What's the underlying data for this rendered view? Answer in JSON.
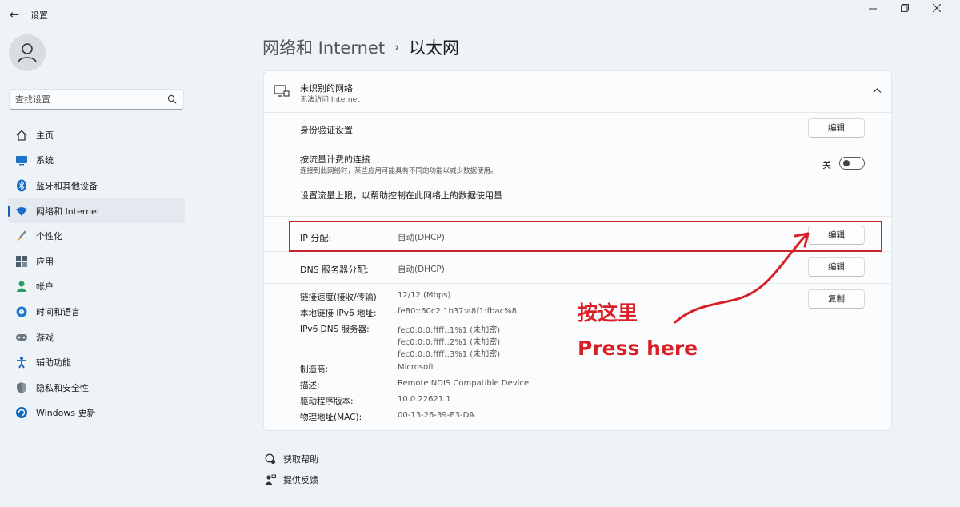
{
  "window": {
    "title": "设置",
    "controls": [
      "minimize",
      "maximize",
      "close"
    ]
  },
  "sidebar": {
    "search_placeholder": "查找设置",
    "items": [
      {
        "label": "主页",
        "icon": "home-icon",
        "color": "#333333"
      },
      {
        "label": "系统",
        "icon": "monitor-icon",
        "color": "#0f6cbd"
      },
      {
        "label": "蓝牙和其他设备",
        "icon": "bluetooth-icon",
        "color": "#0f6cbd"
      },
      {
        "label": "网络和 Internet",
        "icon": "wifi-icon",
        "color": "#0f6cbd",
        "active": true
      },
      {
        "label": "个性化",
        "icon": "brush-icon",
        "color": "#e8a33c"
      },
      {
        "label": "应用",
        "icon": "apps-icon",
        "color": "#4a5b6c"
      },
      {
        "label": "帐户",
        "icon": "person-icon",
        "color": "#2d9b63"
      },
      {
        "label": "时间和语言",
        "icon": "globe-clock-icon",
        "color": "#1a7bd0"
      },
      {
        "label": "游戏",
        "icon": "gamepad-icon",
        "color": "#6b7682"
      },
      {
        "label": "辅助功能",
        "icon": "accessibility-icon",
        "color": "#1a5fb4"
      },
      {
        "label": "隐私和安全性",
        "icon": "shield-icon",
        "color": "#6b7682"
      },
      {
        "label": "Windows 更新",
        "icon": "update-icon",
        "color": "#0f6cbd"
      }
    ]
  },
  "header": {
    "parent": "网络和 Internet",
    "separator": "›",
    "current": "以太网"
  },
  "network": {
    "name": "未识别的网络",
    "status": "无法访问 Internet",
    "auth_label": "身份验证设置",
    "auth_button": "编辑",
    "metered_label": "按流量计费的连接",
    "metered_desc": "连接到此网络时，某些应用可能具有不同的功能以减少数据使用。",
    "metered_state": "关",
    "data_limit_link": "设置流量上限，以帮助控制在此网络上的数据使用量",
    "ip_label": "IP 分配:",
    "ip_value": "自动(DHCP)",
    "ip_button": "编辑",
    "dns_label": "DNS 服务器分配:",
    "dns_value": "自动(DHCP)",
    "dns_button": "编辑",
    "copy_button": "复制",
    "properties": [
      {
        "key": "链接速度(接收/传输):",
        "values": [
          "12/12 (Mbps)"
        ]
      },
      {
        "key": "本地链接 IPv6 地址:",
        "values": [
          "fe80::60c2:1b37:a8f1:fbac%8"
        ]
      },
      {
        "key": "IPv6 DNS 服务器:",
        "values": [
          "fec0:0:0:ffff::1%1 (未加密)",
          "fec0:0:0:ffff::2%1 (未加密)",
          "fec0:0:0:ffff::3%1 (未加密)"
        ]
      },
      {
        "key": "制造商:",
        "values": [
          "Microsoft"
        ]
      },
      {
        "key": "描述:",
        "values": [
          "Remote NDIS Compatible Device"
        ]
      },
      {
        "key": "驱动程序版本:",
        "values": [
          "10.0.22621.1"
        ]
      },
      {
        "key": "物理地址(MAC):",
        "values": [
          "00-13-26-39-E3-DA"
        ]
      }
    ]
  },
  "annotation": {
    "text_cn": "按这里",
    "text_en": "Press here",
    "color": "#d81f26"
  },
  "footer": {
    "help": "获取帮助",
    "feedback": "提供反馈"
  }
}
